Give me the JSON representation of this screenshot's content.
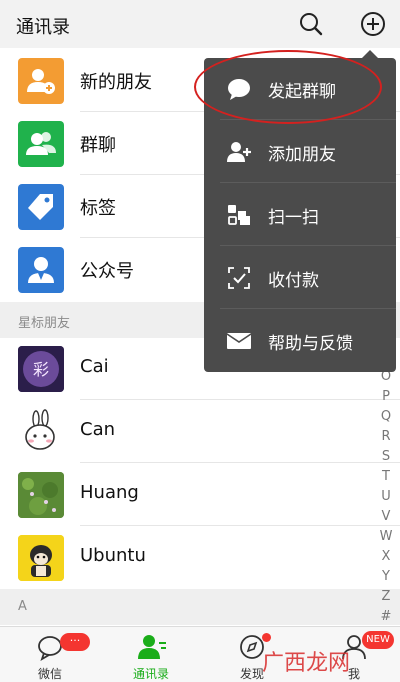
{
  "header": {
    "title": "通讯录",
    "search_icon": "search-icon",
    "add_icon": "plus-circle-icon"
  },
  "fixed_entries": [
    {
      "label": "新的朋友",
      "color": "#f39c33",
      "icon": "add-friend-icon"
    },
    {
      "label": "群聊",
      "color": "#20b24c",
      "icon": "group-icon"
    },
    {
      "label": "标签",
      "color": "#2f79d3",
      "icon": "tag-icon"
    },
    {
      "label": "公众号",
      "color": "#2f79d3",
      "icon": "official-account-icon"
    }
  ],
  "sections": [
    {
      "label": "星标朋友"
    },
    {
      "label": "A"
    }
  ],
  "starred_contacts": [
    {
      "name": "Cai"
    },
    {
      "name": "Can"
    },
    {
      "name": "Huang"
    },
    {
      "name": "Ubuntu"
    }
  ],
  "index_letters": [
    "O",
    "P",
    "Q",
    "R",
    "S",
    "T",
    "U",
    "V",
    "W",
    "X",
    "Y",
    "Z",
    "#"
  ],
  "popup_menu": {
    "items": [
      {
        "label": "发起群聊",
        "icon": "chat-bubble-icon"
      },
      {
        "label": "添加朋友",
        "icon": "add-friend-icon"
      },
      {
        "label": "扫一扫",
        "icon": "scan-icon"
      },
      {
        "label": "收付款",
        "icon": "payment-icon"
      },
      {
        "label": "帮助与反馈",
        "icon": "mail-icon"
      }
    ],
    "highlight_color": "#d4211f"
  },
  "tabbar": {
    "tabs": [
      {
        "label": "微信",
        "badge": "···"
      },
      {
        "label": "通讯录",
        "active": true
      },
      {
        "label": "发现"
      },
      {
        "label": "我",
        "badge": "NEW"
      }
    ],
    "active_color": "#1aad19"
  },
  "watermark": {
    "text": "广西龙网"
  }
}
